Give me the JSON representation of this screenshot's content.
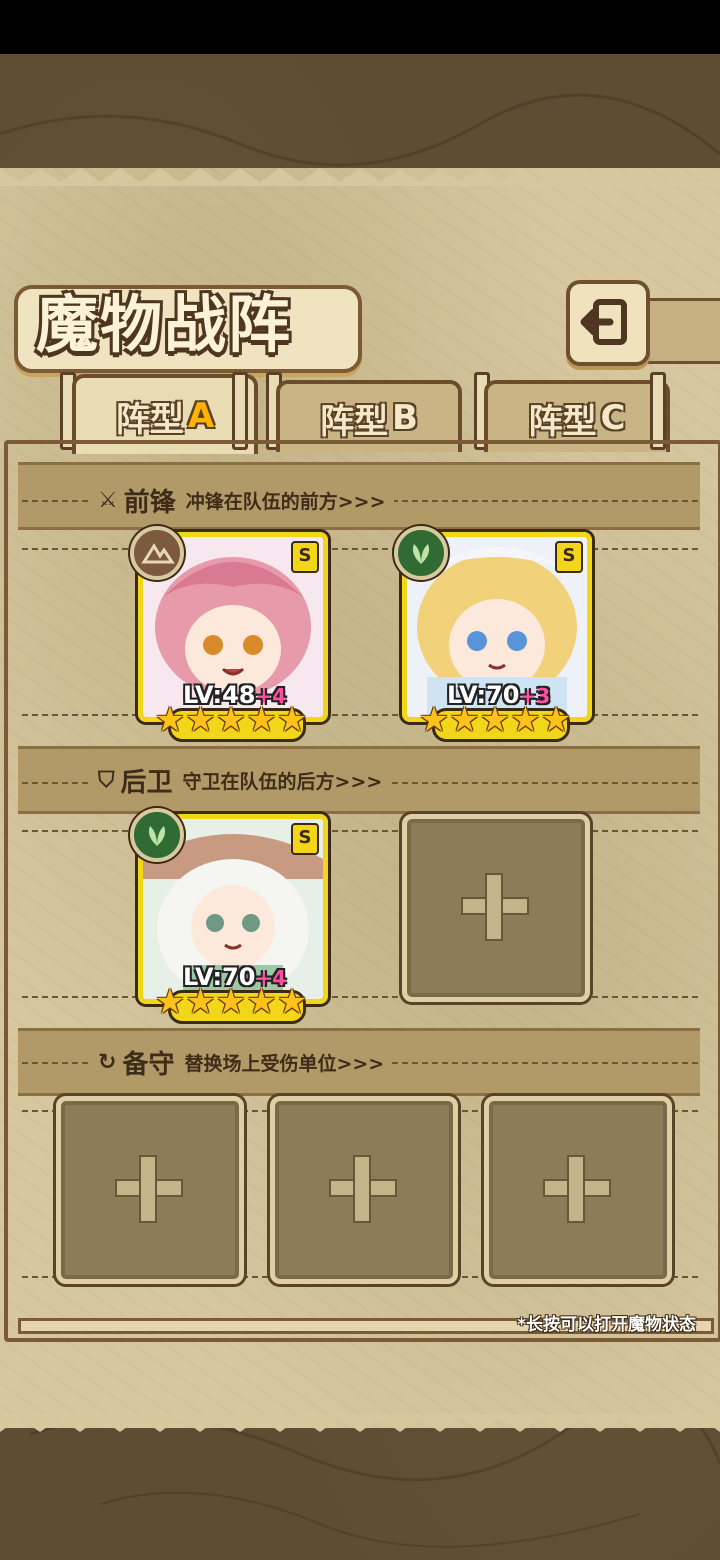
{
  "title": "魔物战阵",
  "tabs": [
    {
      "label": "阵型",
      "letter": "A",
      "active": true
    },
    {
      "label": "阵型",
      "letter": "B",
      "active": false
    },
    {
      "label": "阵型",
      "letter": "C",
      "active": false
    }
  ],
  "sections": {
    "vanguard": {
      "name": "前锋",
      "desc": "冲锋在队伍的前方>>>"
    },
    "rearguard": {
      "name": "后卫",
      "desc": "守卫在队伍的后方>>>"
    },
    "reserve": {
      "name": "备守",
      "desc": "替换场上受伤单位>>>"
    }
  },
  "units": [
    {
      "lv": "LV:48",
      "plus": "+4",
      "rank": "S",
      "element": "earth-icon",
      "stars": 5
    },
    {
      "lv": "LV:70",
      "plus": "+3",
      "rank": "S",
      "element": "leaf-icon",
      "stars": 5
    },
    {
      "lv": "LV:70",
      "plus": "+4",
      "rank": "S",
      "element": "leaf-icon",
      "stars": 5
    }
  ],
  "hint": "*长按可以打开魔物状态",
  "colors": {
    "frame": "#7a5b35",
    "card_border": "#f2d61a",
    "star": "#ffc21a",
    "plus": "#ff4fa0"
  }
}
